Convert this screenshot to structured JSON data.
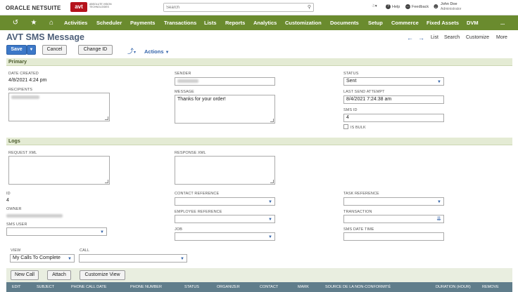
{
  "topbar": {
    "oracle": "ORACLE",
    "netsuite": "NETSUITE",
    "avt_logo": "avt",
    "avt_tagline": "ABSOLUTE VISION TECHNOLOGIES",
    "search_placeholder": "Search",
    "help_label": "Help",
    "feedback_label": "Feedback",
    "user_name": "John Doe",
    "user_role": "Administrator"
  },
  "nav": {
    "items": [
      "Activities",
      "Scheduler",
      "Payments",
      "Transactions",
      "Lists",
      "Reports",
      "Analytics",
      "Customization",
      "Documents",
      "Setup",
      "Commerce",
      "Fixed Assets",
      "DVM"
    ],
    "more": "..."
  },
  "page": {
    "title": "AVT SMS Message",
    "list_link": "List",
    "search_link": "Search",
    "customize_link": "Customize",
    "more_link": "More"
  },
  "toolbar": {
    "save": "Save",
    "cancel": "Cancel",
    "change_id": "Change ID",
    "actions": "Actions"
  },
  "primary": {
    "header": "Primary",
    "date_created_label": "DATE CREATED",
    "date_created_value": "4/8/2021 4:24 pm",
    "recipients_label": "RECIPIENTS",
    "sender_label": "SENDER",
    "message_label": "MESSAGE",
    "message_value": "Thanks for your order!",
    "status_label": "STATUS",
    "status_value": "Sent",
    "last_send_label": "LAST SEND ATTEMPT",
    "last_send_value": "8/4/2021 7:24:38 am",
    "sms_id_label": "SMS ID",
    "sms_id_value": "4",
    "is_bulk_label": "IS BULK"
  },
  "logs": {
    "header": "Logs",
    "request_xml_label": "REQUEST XML",
    "response_xml_label": "RESPONSE XML",
    "id_label": "ID",
    "id_value": "4",
    "owner_label": "OWNER",
    "sms_user_label": "SMS USER",
    "contact_ref_label": "CONTACT REFERENCE",
    "employee_ref_label": "EMPLOYEE REFERENCE",
    "job_label": "JOB",
    "task_ref_label": "TASK REFERENCE",
    "transaction_label": "TRANSACTION",
    "sms_date_time_label": "SMS DATE TIME"
  },
  "calls": {
    "view_label": "VIEW",
    "view_value": "My Calls To Complete",
    "call_label": "CALL",
    "new_call": "New Call",
    "attach": "Attach",
    "customize_view": "Customize View",
    "columns": [
      "EDIT",
      "SUBJECT",
      "PHONE CALL DATE",
      "PHONE NUMBER",
      "STATUS",
      "ORGANIZER",
      "CONTACT",
      "MARK",
      "SOURCE DE LA NON-CONFORMITÉ",
      "DURATION (HOUR)",
      "REMOVE"
    ]
  },
  "colors": {
    "nav_green": "#6a8b2e",
    "section_bg": "#e4ebd4",
    "primary_blue": "#3c78c8",
    "title_slate": "#4d5f79",
    "avt_red": "#b5121b",
    "list_header": "#607d8b"
  },
  "icons": [
    "recent-records-icon",
    "star-icon",
    "home-icon",
    "search-icon",
    "shortcuts-icon",
    "help-icon",
    "feedback-icon",
    "user-icon",
    "back-arrow-icon",
    "forward-arrow-icon",
    "action-history-icon"
  ]
}
